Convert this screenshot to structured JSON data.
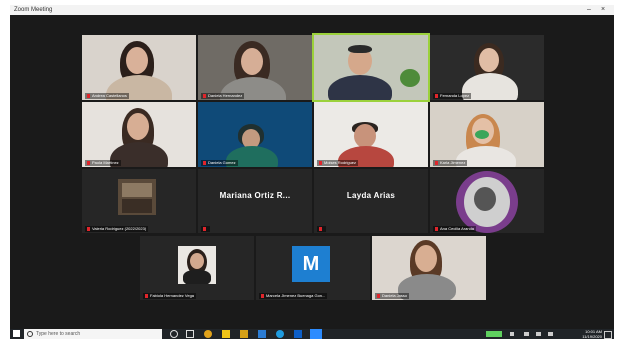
{
  "window": {
    "app_title": "Zoom Meeting"
  },
  "participants": [
    {
      "name": "Andrea Castellanos"
    },
    {
      "name": "Daniela Hernandez"
    },
    {
      "name": ""
    },
    {
      "name": "Fernanda Lopez"
    },
    {
      "name": "Paola Martinez"
    },
    {
      "name": "Daniela Gomez"
    },
    {
      "name": "Moises Rodriguez"
    },
    {
      "name": "Karla Jimenez"
    },
    {
      "name": "Valeria Rodriguez (2022/2023)"
    },
    {
      "name": "Mariana Ortiz R...",
      "display": "Mariana Ortiz R..."
    },
    {
      "name": "Layda Arias",
      "display": "Layda Arias"
    },
    {
      "name": "Ana Cecilia Aranda"
    },
    {
      "name": "Fabiola Hernandez Vega"
    },
    {
      "name": "Marcela Jimenez Buenaga Gon...",
      "display": "M"
    },
    {
      "name": "Daniela Jasso"
    }
  ],
  "taskbar": {
    "search_placeholder": "Type here to search",
    "time": "10:01 AM",
    "date": "11/19/2020"
  }
}
